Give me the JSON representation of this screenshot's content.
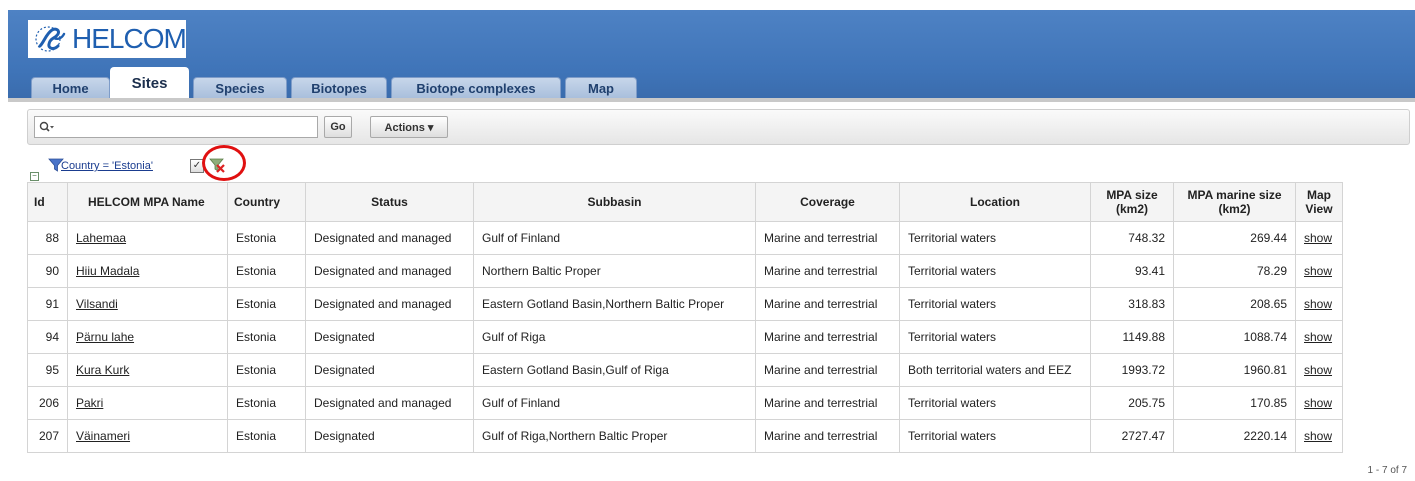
{
  "app": {
    "logo_text": "HELCOM"
  },
  "tabs": [
    {
      "label": "Home",
      "active": false
    },
    {
      "label": "Sites",
      "active": true
    },
    {
      "label": "Species",
      "active": false
    },
    {
      "label": "Biotopes",
      "active": false
    },
    {
      "label": "Biotope complexes",
      "active": false
    },
    {
      "label": "Map",
      "active": false
    }
  ],
  "search": {
    "value": "",
    "go_label": "Go",
    "actions_label": "Actions ▾",
    "search_icon": "magnifier-dropdown-icon"
  },
  "filter": {
    "label": "Country = 'Estonia'",
    "checked": true,
    "filter_icon": "funnel-icon",
    "remove_icon": "remove-filter-icon",
    "highlight_color": "#e01010"
  },
  "table": {
    "headers": {
      "id": "Id",
      "name": "HELCOM MPA Name",
      "country": "Country",
      "status": "Status",
      "subbasin": "Subbasin",
      "coverage": "Coverage",
      "location": "Location",
      "size_l1": "MPA size",
      "size_l2": "(km2)",
      "marine_l1": "MPA marine size",
      "marine_l2": "(km2)",
      "map_l1": "Map",
      "map_l2": "View"
    },
    "rows": [
      {
        "id": "88",
        "name": "Lahemaa",
        "country": "Estonia",
        "status": "Designated and managed",
        "subbasin": "Gulf of Finland",
        "coverage": "Marine and terrestrial",
        "location": "Territorial waters",
        "size": "748.32",
        "marine": "269.44",
        "map": "show"
      },
      {
        "id": "90",
        "name": "Hiiu Madala",
        "country": "Estonia",
        "status": "Designated and managed",
        "subbasin": "Northern Baltic Proper",
        "coverage": "Marine and terrestrial",
        "location": "Territorial waters",
        "size": "93.41",
        "marine": "78.29",
        "map": "show"
      },
      {
        "id": "91",
        "name": "Vilsandi",
        "country": "Estonia",
        "status": "Designated and managed",
        "subbasin": "Eastern Gotland Basin,Northern Baltic Proper",
        "coverage": "Marine and terrestrial",
        "location": "Territorial waters",
        "size": "318.83",
        "marine": "208.65",
        "map": "show"
      },
      {
        "id": "94",
        "name": "Pärnu lahe",
        "country": "Estonia",
        "status": "Designated",
        "subbasin": "Gulf of Riga",
        "coverage": "Marine and terrestrial",
        "location": "Territorial waters",
        "size": "1149.88",
        "marine": "1088.74",
        "map": "show"
      },
      {
        "id": "95",
        "name": "Kura Kurk",
        "country": "Estonia",
        "status": "Designated",
        "subbasin": "Eastern Gotland Basin,Gulf of Riga",
        "coverage": "Marine and terrestrial",
        "location": "Both territorial waters and EEZ",
        "size": "1993.72",
        "marine": "1960.81",
        "map": "show"
      },
      {
        "id": "206",
        "name": "Pakri",
        "country": "Estonia",
        "status": "Designated and managed",
        "subbasin": "Gulf of Finland",
        "coverage": "Marine and terrestrial",
        "location": "Territorial waters",
        "size": "205.75",
        "marine": "170.85",
        "map": "show"
      },
      {
        "id": "207",
        "name": "Väinameri",
        "country": "Estonia",
        "status": "Designated",
        "subbasin": "Gulf of Riga,Northern Baltic Proper",
        "coverage": "Marine and terrestrial",
        "location": "Territorial waters",
        "size": "2727.47",
        "marine": "2220.14",
        "map": "show"
      }
    ]
  },
  "pagination": {
    "text": "1 - 7 of 7"
  },
  "colors": {
    "header_blue": "#4e82c4",
    "tab_inactive": "#b7cae4",
    "tab_text": "#20406e"
  }
}
